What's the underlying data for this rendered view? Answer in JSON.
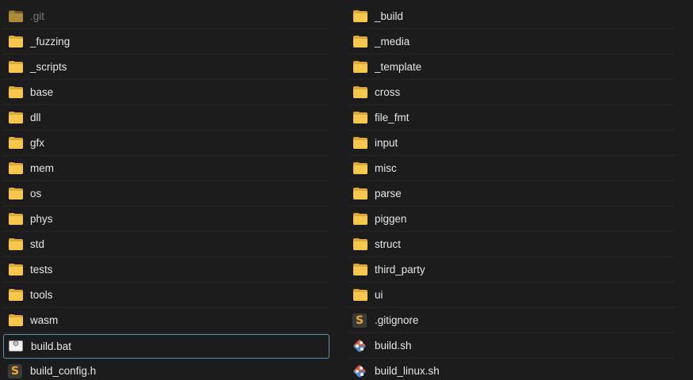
{
  "left_column": [
    {
      "name": ".git",
      "icon": "folder-icon",
      "dim": true
    },
    {
      "name": "_fuzzing",
      "icon": "folder-icon"
    },
    {
      "name": "_scripts",
      "icon": "folder-icon"
    },
    {
      "name": "base",
      "icon": "folder-icon"
    },
    {
      "name": "dll",
      "icon": "folder-icon"
    },
    {
      "name": "gfx",
      "icon": "folder-icon"
    },
    {
      "name": "mem",
      "icon": "folder-icon"
    },
    {
      "name": "os",
      "icon": "folder-icon"
    },
    {
      "name": "phys",
      "icon": "folder-icon"
    },
    {
      "name": "std",
      "icon": "folder-icon"
    },
    {
      "name": "tests",
      "icon": "folder-icon"
    },
    {
      "name": "tools",
      "icon": "folder-icon"
    },
    {
      "name": "wasm",
      "icon": "folder-icon"
    },
    {
      "name": "build.bat",
      "icon": "batch-file-icon",
      "selected": true
    },
    {
      "name": "build_config.h",
      "icon": "sublime-file-icon"
    }
  ],
  "right_column": [
    {
      "name": "_build",
      "icon": "folder-icon"
    },
    {
      "name": "_media",
      "icon": "folder-icon"
    },
    {
      "name": "_template",
      "icon": "folder-icon"
    },
    {
      "name": "cross",
      "icon": "folder-icon"
    },
    {
      "name": "file_fmt",
      "icon": "folder-icon"
    },
    {
      "name": "input",
      "icon": "folder-icon"
    },
    {
      "name": "misc",
      "icon": "folder-icon"
    },
    {
      "name": "parse",
      "icon": "folder-icon"
    },
    {
      "name": "piggen",
      "icon": "folder-icon"
    },
    {
      "name": "struct",
      "icon": "folder-icon"
    },
    {
      "name": "third_party",
      "icon": "folder-icon"
    },
    {
      "name": "ui",
      "icon": "folder-icon"
    },
    {
      "name": ".gitignore",
      "icon": "sublime-file-icon"
    },
    {
      "name": "build.sh",
      "icon": "git-shell-icon"
    },
    {
      "name": "build_linux.sh",
      "icon": "git-shell-icon"
    }
  ],
  "colors": {
    "background": "#1c1c1c",
    "text": "#e6e6e6",
    "folder": "#f6c74c",
    "selection_border": "#5b8fb0"
  }
}
